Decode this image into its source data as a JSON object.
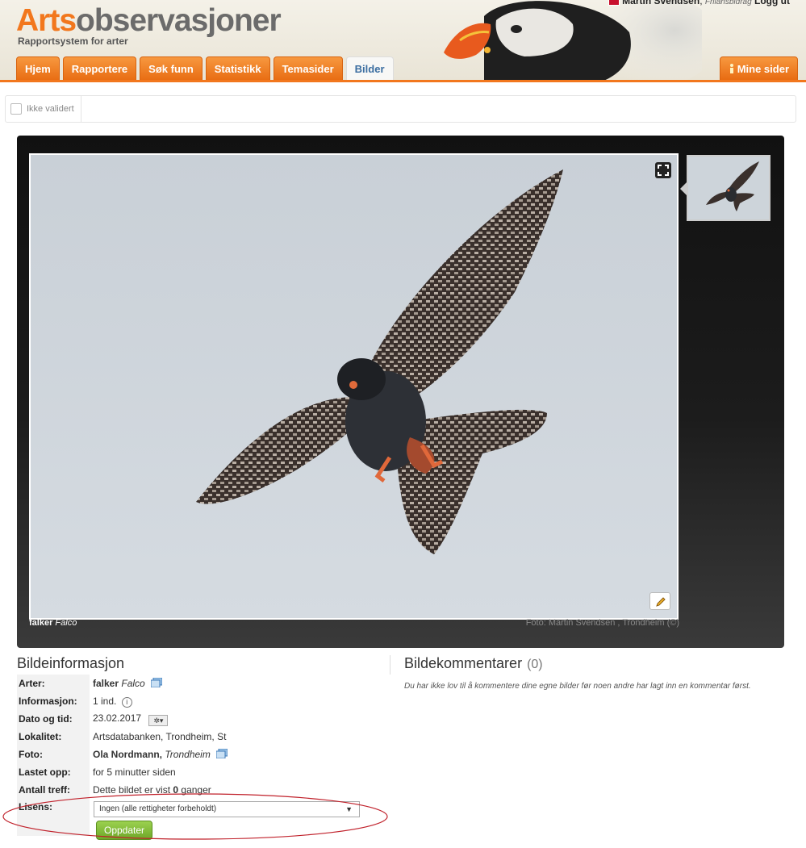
{
  "header": {
    "logo_part1": "Arts",
    "logo_part2": "observasjoner",
    "tagline": "Rapportsystem for arter",
    "user_name": "Martin Svendsen",
    "user_sub": "Frilansbidrag",
    "logout_label": "Logg ut"
  },
  "nav": {
    "tabs": [
      "Hjem",
      "Rapportere",
      "Søk funn",
      "Statistikk",
      "Temasider",
      "Bilder"
    ],
    "active_tab": "Bilder",
    "mine_sider": "Mine sider"
  },
  "toolbar": {
    "not_validated_label": "Ikke validert"
  },
  "viewer": {
    "caption_species": "falker",
    "caption_latin": "Falco",
    "caption_photo": "Foto: Martin Svendsen , Trondheim (©)"
  },
  "info": {
    "title": "Bildeinformasjon",
    "rows": [
      {
        "label": "Arter:",
        "value": "falker",
        "value_latin": "Falco"
      },
      {
        "label": "Informasjon:",
        "value": "1 ind."
      },
      {
        "label": "Dato og tid:",
        "value": "23.02.2017"
      },
      {
        "label": "Lokalitet:",
        "value": "Artsdatabanken, Trondheim, St"
      },
      {
        "label": "Foto:",
        "value": "Ola Nordmann,",
        "value_place": "Trondheim"
      },
      {
        "label": "Lastet opp:",
        "value": "for 5 minutter siden"
      },
      {
        "label": "Antall treff:",
        "value_prefix": "Dette bildet er vist ",
        "value_count": "0",
        "value_suffix": " ganger"
      },
      {
        "label": "Lisens:"
      }
    ],
    "license_selected": "Ingen (alle rettigheter forbeholdt)",
    "update_button": "Oppdater"
  },
  "comments": {
    "title": "Bildekommentarer",
    "count": "(0)",
    "note": "Du har ikke lov til å kommentere dine egne bilder før noen andre har lagt inn en kommentar først."
  },
  "colors": {
    "accent_orange": "#f2771d",
    "tab_active_text": "#3a6da0",
    "update_green": "#7cb733",
    "highlight_red": "#c0202a"
  },
  "icons": [
    "fullscreen-icon",
    "edit-pencil-icon",
    "gallery-icon",
    "info-circle-icon",
    "settings-gear-icon",
    "dropdown-arrow-icon",
    "flag-icon",
    "person-icon"
  ]
}
